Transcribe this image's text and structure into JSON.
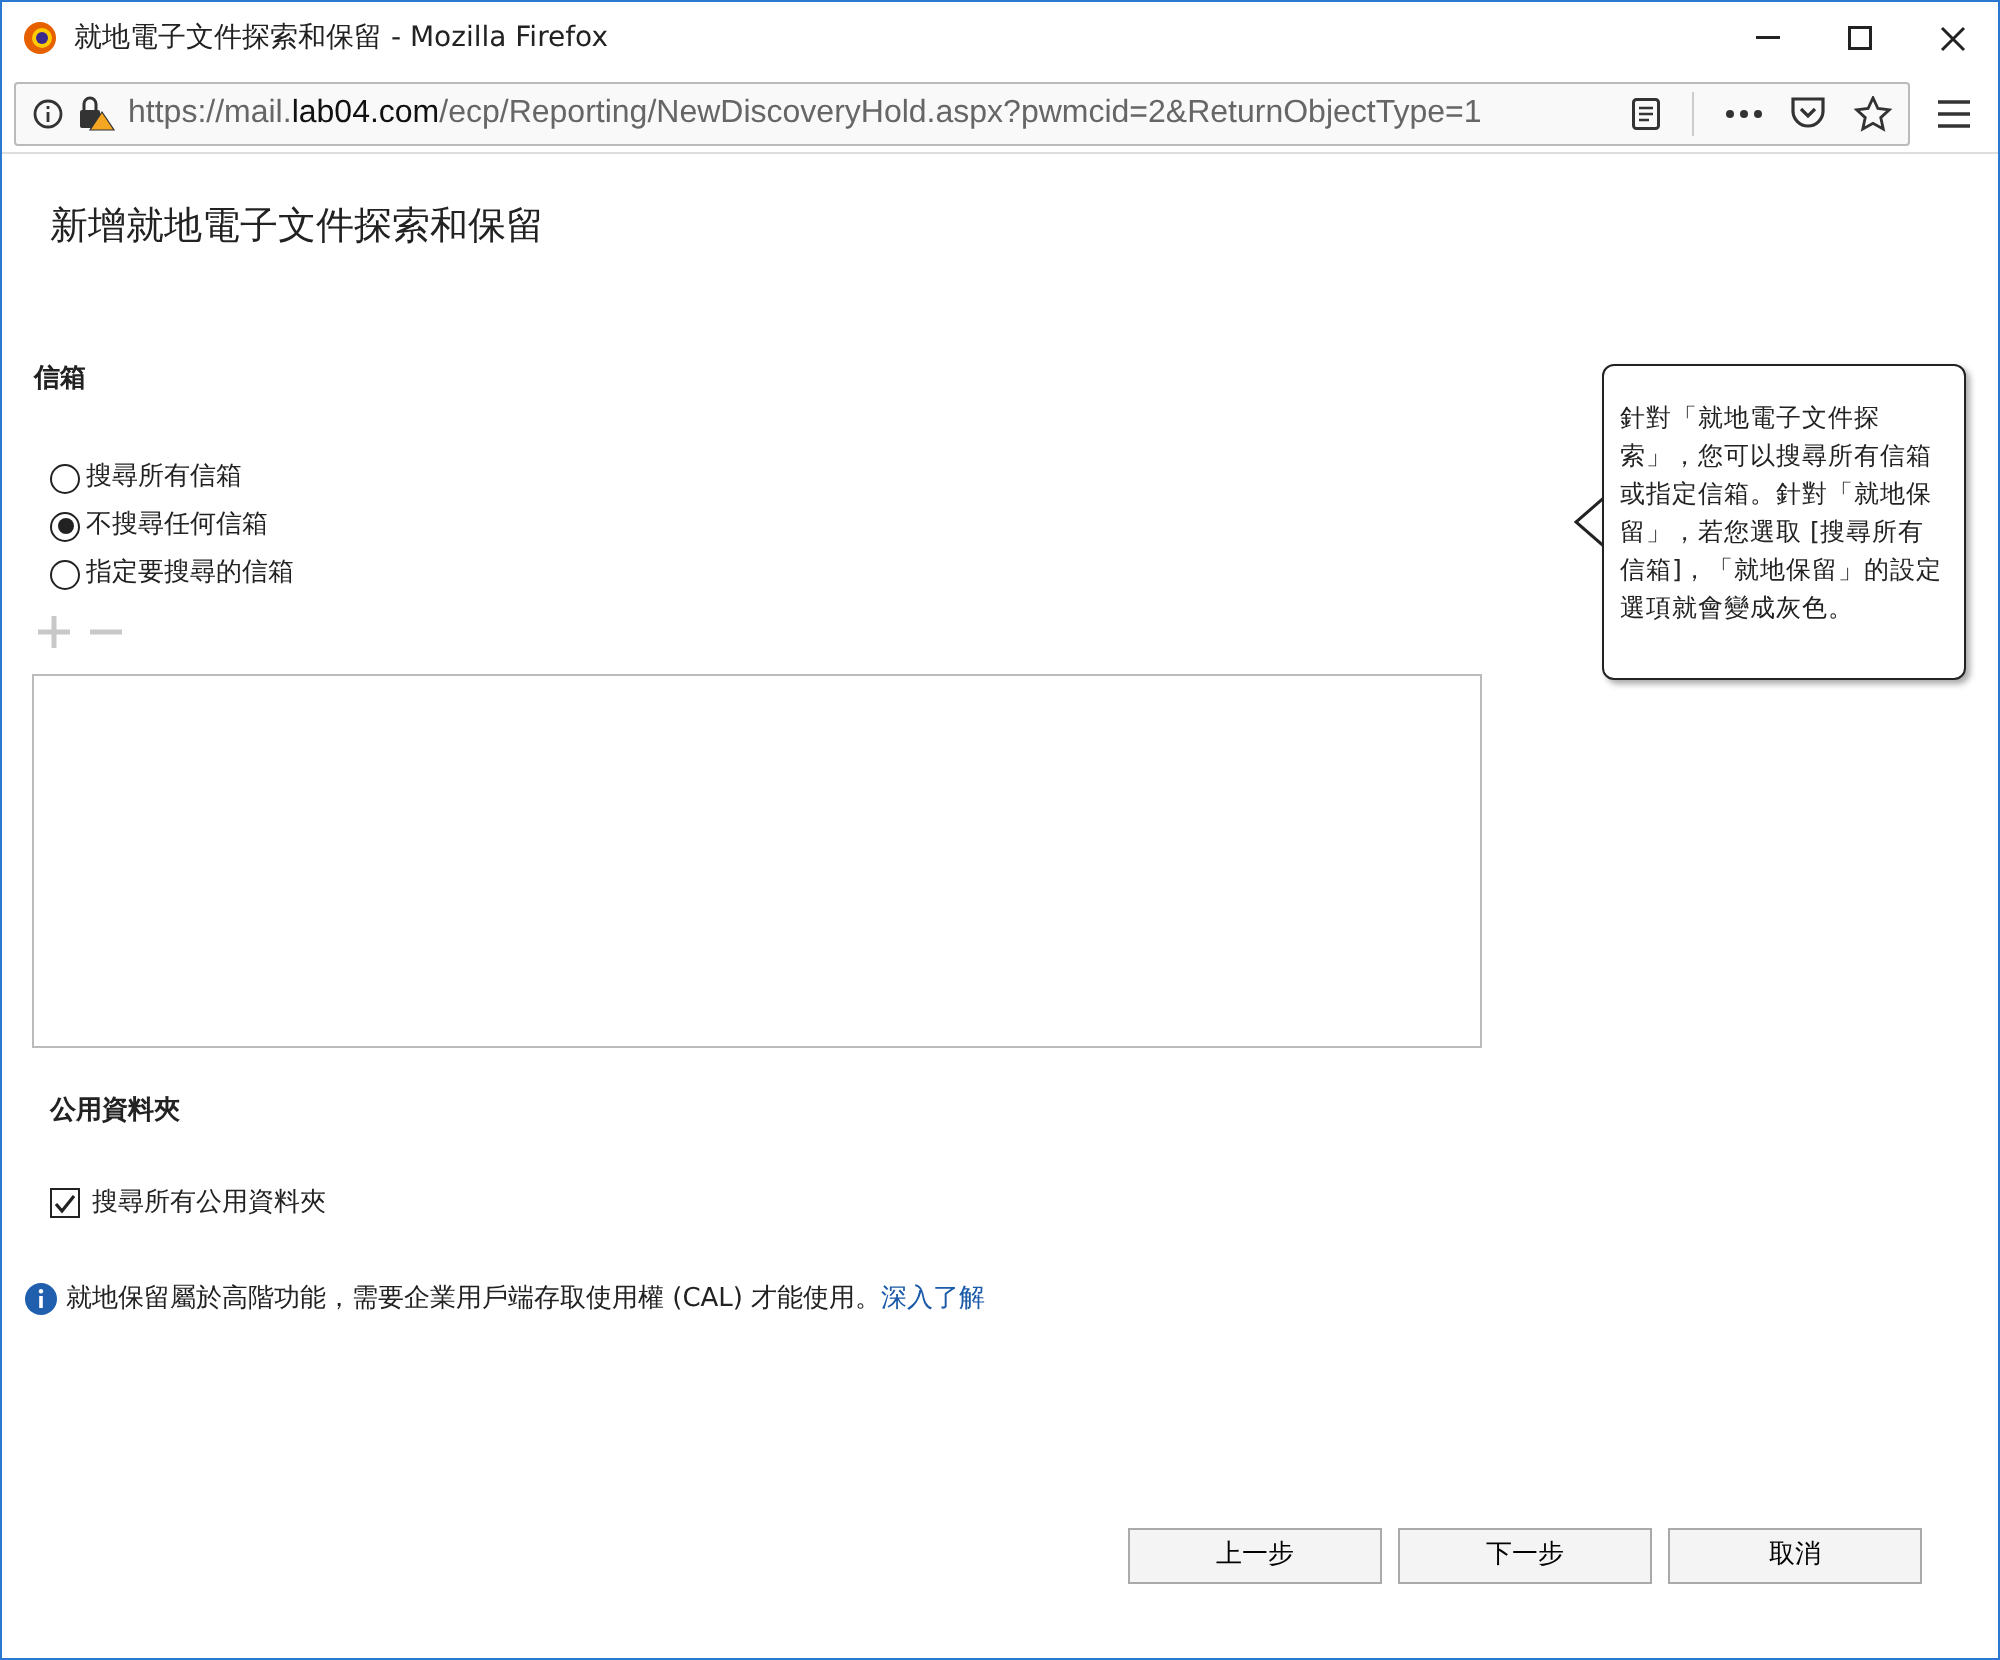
{
  "window": {
    "title": "就地電子文件探索和保留 - Mozilla Firefox"
  },
  "address_bar": {
    "url": "https://mail.**lab04.com**/ecp/Reporting/NewDiscoveryHold.aspx?pwmcid=2&ReturnObjectType=1"
  },
  "page_title": "新增就地電子文件探索和保留",
  "mailboxes": {
    "heading": "信箱",
    "options": [
      {
        "label": "搜尋所有信箱",
        "selected": false
      },
      {
        "label": "不搜尋任何信箱",
        "selected": true
      },
      {
        "label": "指定要搜尋的信箱",
        "selected": false
      }
    ],
    "toolbar": {
      "disabled": true
    }
  },
  "tooltip": {
    "text": "針對「就地電子文件探索」，您可以搜尋所有信箱或指定信箱。針對「就地保留」，若您選取 [搜尋所有信箱]，「就地保留」的設定選項就會變成灰色。"
  },
  "public_folders": {
    "heading": "公用資料夾",
    "checkbox": {
      "label": "搜尋所有公用資料夾",
      "checked": true
    }
  },
  "info": {
    "text": "就地保留屬於高階功能，需要企業用戶端存取使用權 (CAL) 才能使用。",
    "link": "深入了解"
  },
  "buttons": [
    "上一步",
    "下一步",
    "取消"
  ]
}
